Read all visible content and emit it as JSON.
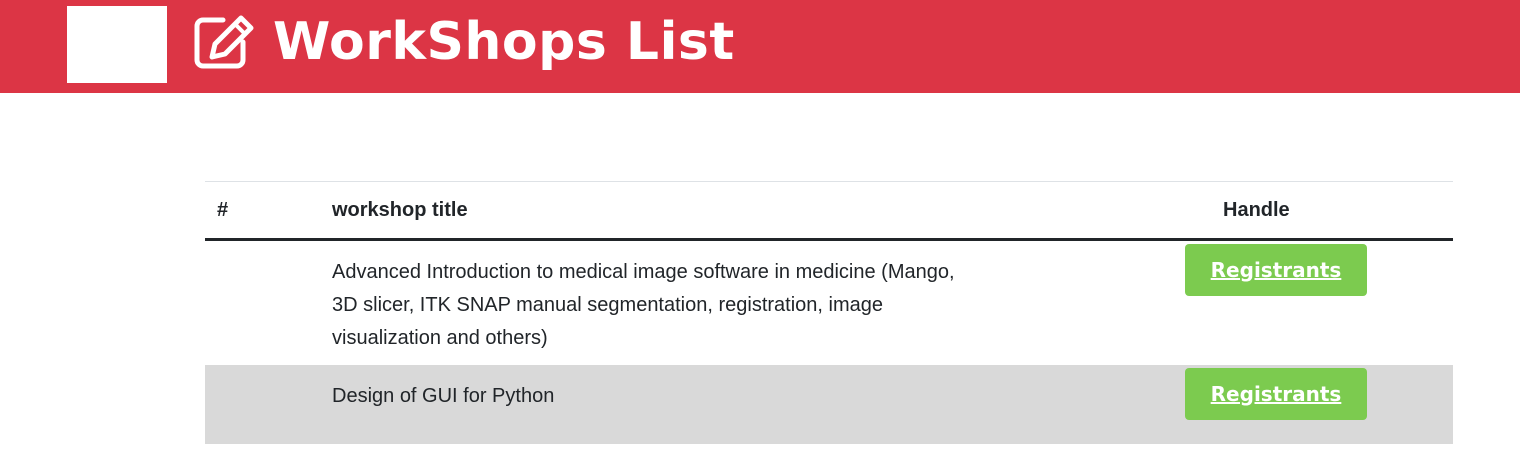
{
  "header": {
    "title": "WorkShops List",
    "icon": "edit-icon",
    "background_color": "#dc3545"
  },
  "table": {
    "columns": [
      "#",
      "workshop title",
      "Handle"
    ],
    "rows": [
      {
        "number": "",
        "title": "Advanced Introduction to medical image software in medicine (Mango, 3D slicer, ITK SNAP manual segmentation, registration, image visualization and others)",
        "action_label": "Registrants"
      },
      {
        "number": "",
        "title": "Design of GUI for Python",
        "action_label": "Registrants"
      }
    ],
    "button_color": "#7ccb4f",
    "striped_row_color": "#d9d9d9"
  }
}
